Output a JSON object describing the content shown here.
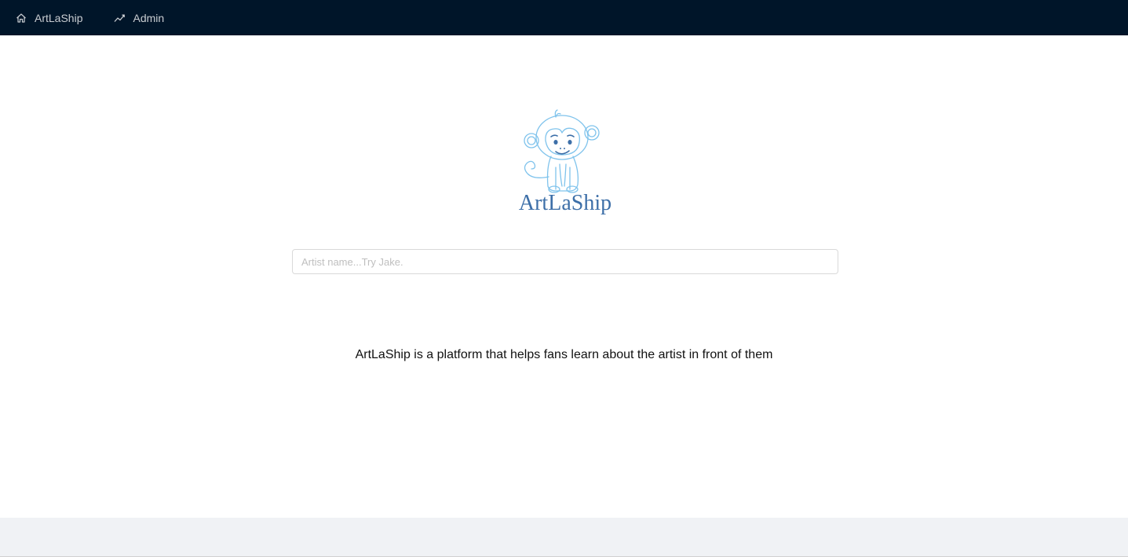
{
  "nav": {
    "items": [
      {
        "label": "ArtLaShip",
        "icon": "home-icon"
      },
      {
        "label": "Admin",
        "icon": "line-chart-icon"
      }
    ]
  },
  "logo": {
    "text": "ArtLaShip",
    "colors": {
      "outline": "#7fc3ec",
      "text": "#3d6fa8"
    }
  },
  "search": {
    "placeholder": "Artist name...Try Jake.",
    "value": ""
  },
  "tagline": "ArtLaShip is a platform that helps fans learn about the artist in front of them",
  "colors": {
    "header_bg": "#001529",
    "footer_bg": "#f0f2f5"
  }
}
